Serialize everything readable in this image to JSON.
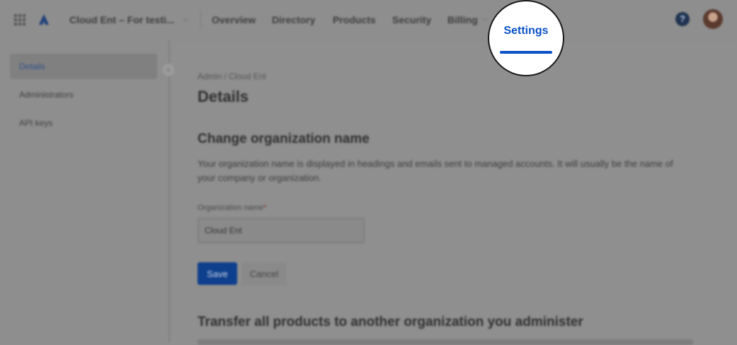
{
  "topbar": {
    "org_name": "Cloud Ent – For testi...",
    "nav": [
      "Overview",
      "Directory",
      "Products",
      "Security",
      "Billing"
    ],
    "help_glyph": "?"
  },
  "sidebar": {
    "items": [
      {
        "label": "Details",
        "active": true
      },
      {
        "label": "Administrators",
        "active": false
      },
      {
        "label": "API keys",
        "active": false
      }
    ]
  },
  "main": {
    "breadcrumb": "Admin / Cloud Ent",
    "title": "Details",
    "section1": {
      "heading": "Change organization name",
      "description": "Your organization name is displayed in headings and emails sent to managed accounts. It will usually be the name of your company or organization.",
      "field_label": "Organization name",
      "required_marker": "*",
      "field_value": "Cloud Ent",
      "save_label": "Save",
      "cancel_label": "Cancel"
    },
    "section2": {
      "heading": "Transfer all products to another organization you administer"
    }
  },
  "highlight": {
    "label": "Settings",
    "accent_color": "#0b52c7"
  },
  "icons": [
    "app-grid-icon",
    "atlassian-logo-icon",
    "chevron-down-icon",
    "help-icon",
    "collapse-chevron-icon"
  ]
}
